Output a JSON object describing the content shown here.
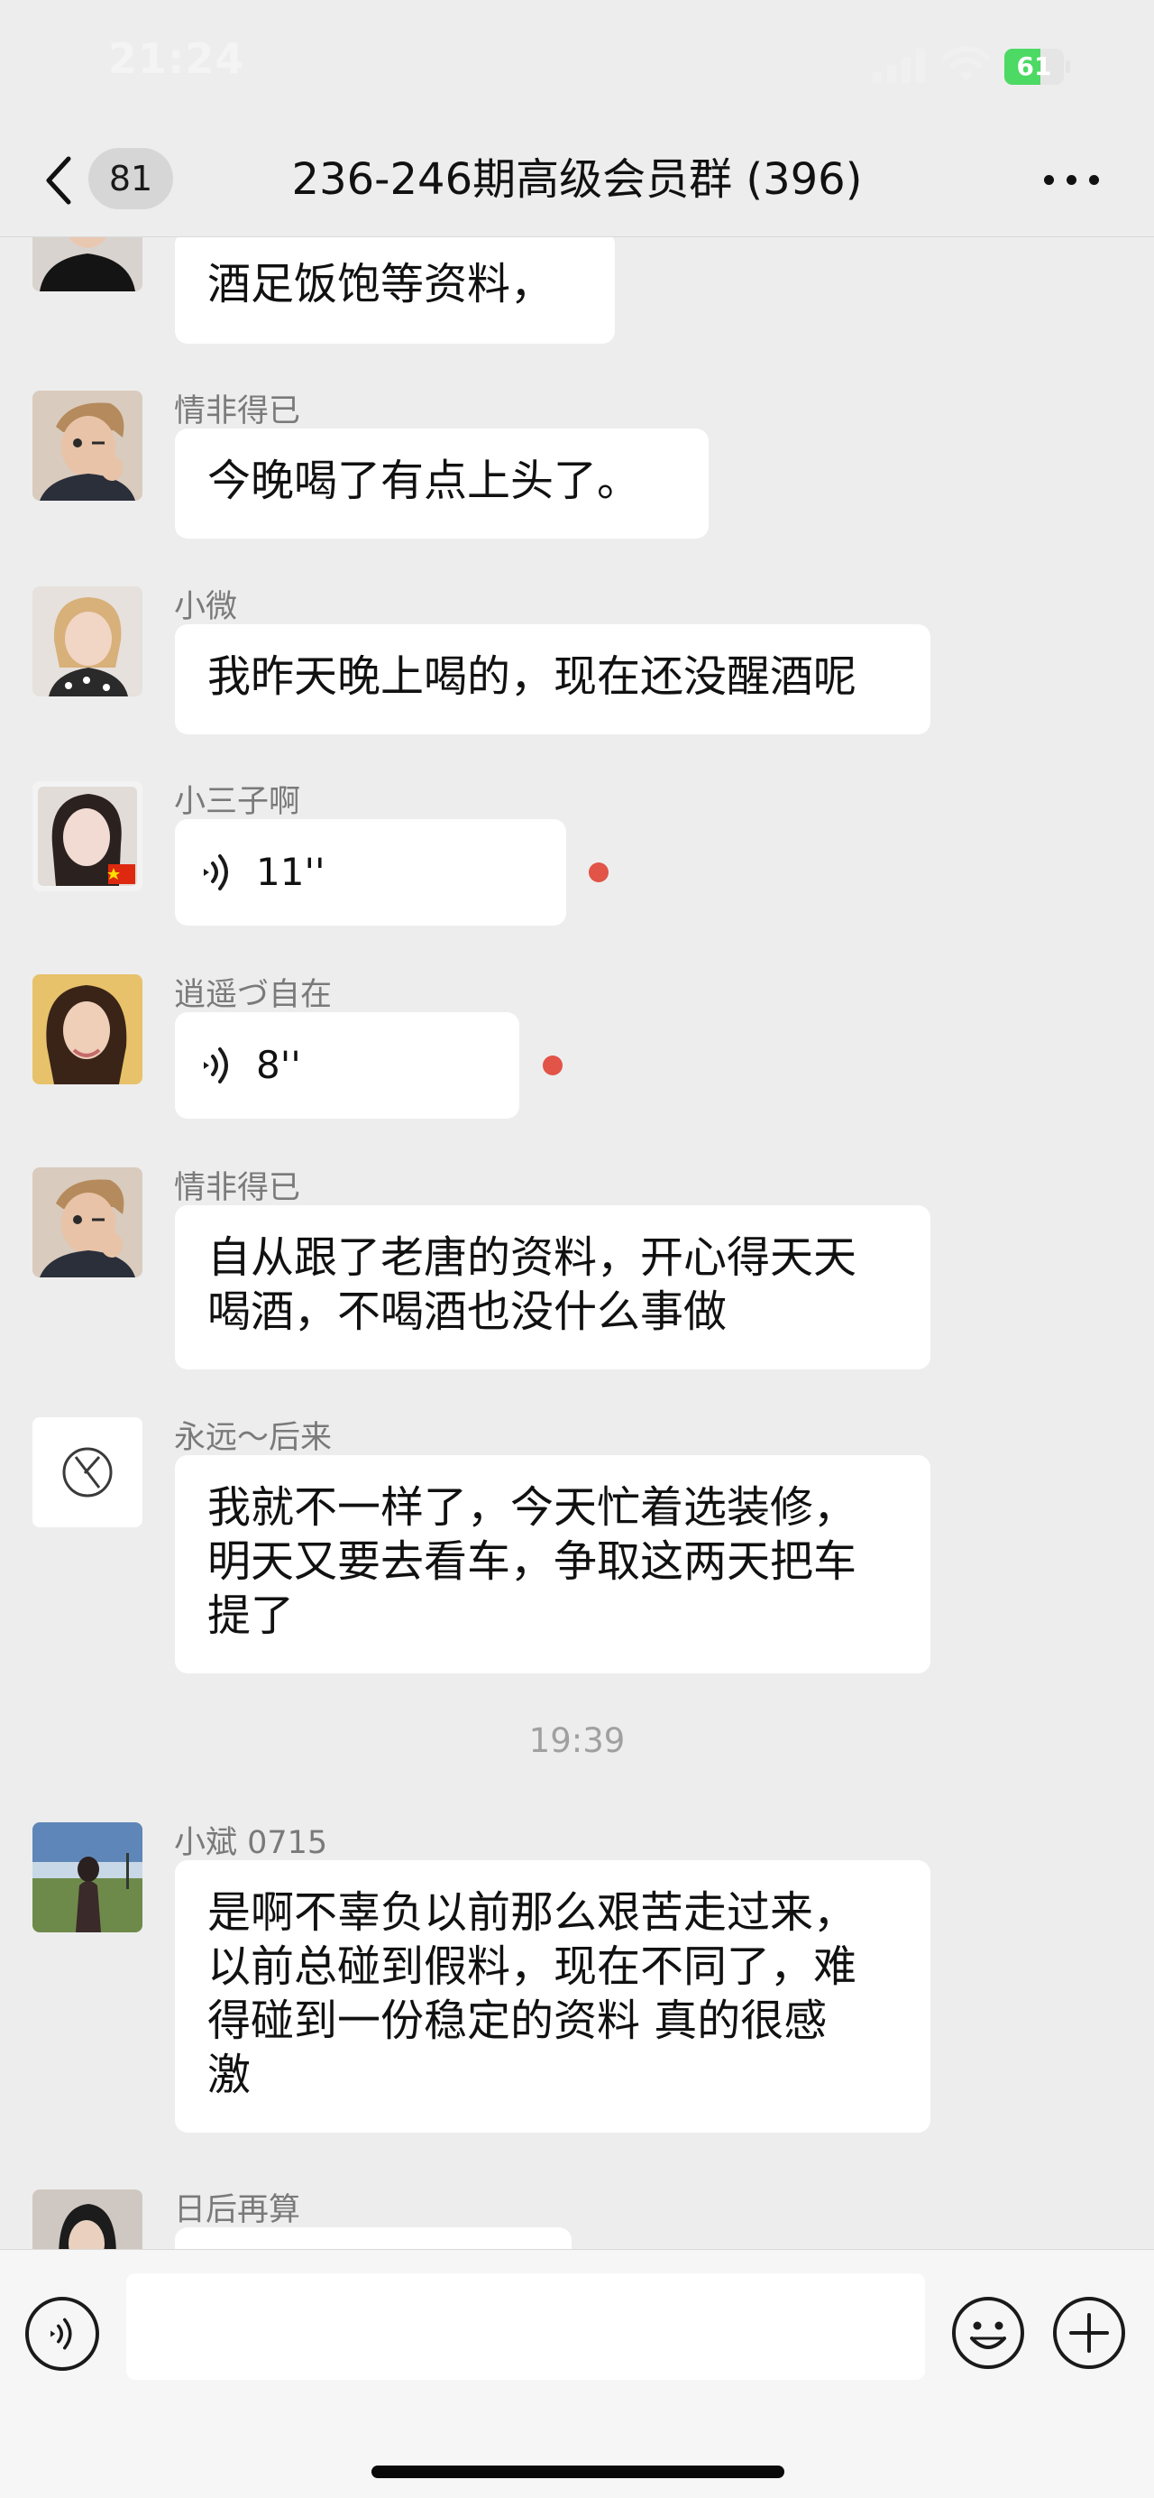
{
  "status_bar": {
    "time": "21:24",
    "battery": "61",
    "battery_level_percent": 61,
    "icons": [
      "signal-icon",
      "wifi-icon",
      "battery-icon"
    ]
  },
  "nav": {
    "unread_count": "81",
    "title": "236-246期高级会员群 (396)",
    "icons": [
      "back-icon",
      "more-icon"
    ]
  },
  "messages": [
    {
      "type": "text",
      "sender": "",
      "lines": [
        "酒足饭饱等资料，"
      ]
    },
    {
      "type": "text",
      "sender": "情非得已",
      "lines": [
        "今晚喝了有点上头了。"
      ]
    },
    {
      "type": "text",
      "sender": "小微",
      "lines": [
        "我昨天晚上喝的，现在还没醒酒呢"
      ]
    },
    {
      "type": "voice",
      "sender": "小三子啊",
      "duration": "11''",
      "unread": true
    },
    {
      "type": "voice",
      "sender": "逍遥づ自在",
      "duration": "8''",
      "unread": true
    },
    {
      "type": "text",
      "sender": "情非得已",
      "lines": [
        "自从跟了老唐的资料，开心得天天",
        "喝酒，不喝酒也没什么事做"
      ]
    },
    {
      "type": "text",
      "sender": "永远～后来",
      "lines": [
        "我就不一样了，今天忙着选装修，",
        "明天又要去看车，争取这两天把车",
        "提了"
      ]
    },
    {
      "type": "time",
      "time": "19:39"
    },
    {
      "type": "text",
      "sender": "小斌 0715",
      "lines": [
        "是啊不辜负以前那么艰苦走过来，",
        "以前总碰到假料，现在不同了，难",
        "得碰到一份稳定的资料 真的很感",
        "激"
      ]
    },
    {
      "type": "text",
      "sender": "日后再算",
      "lines": []
    }
  ],
  "input_bar": {
    "message_value": "",
    "icons": [
      "voice-input-icon",
      "emoji-icon",
      "plus-icon"
    ]
  },
  "colors": {
    "background": "#ededed",
    "bubble": "#ffffff",
    "unread_dot": "#e25348",
    "battery_fill": "#4cd964"
  }
}
